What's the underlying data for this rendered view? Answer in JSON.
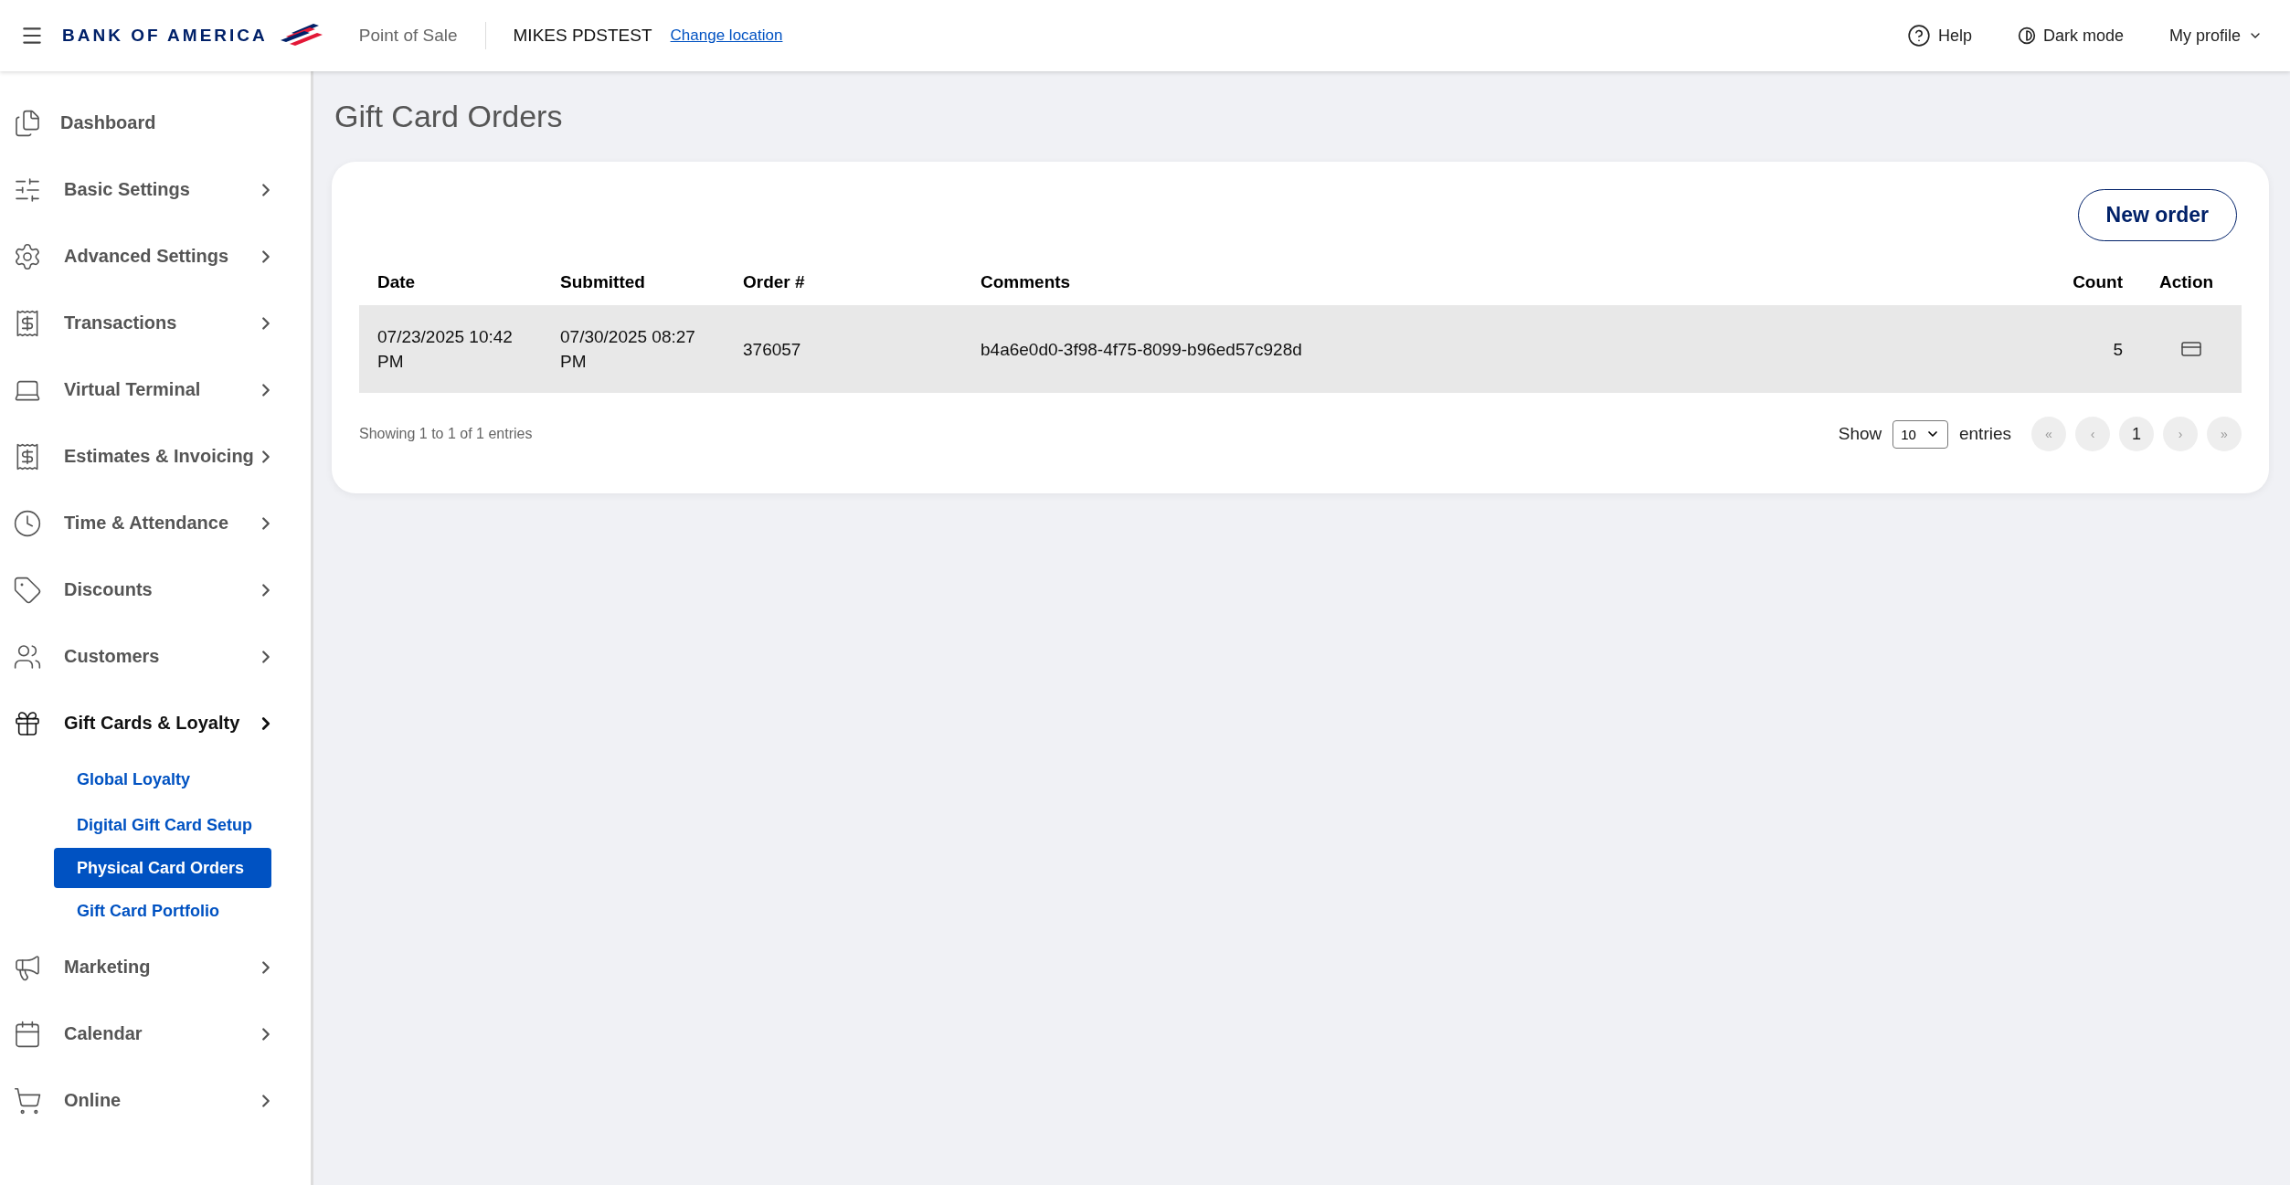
{
  "header": {
    "logo_text": "BANK OF AMERICA",
    "app_name": "Point of Sale",
    "location": "MIKES PDSTEST",
    "change_location": "Change location",
    "help": "Help",
    "dark_mode": "Dark mode",
    "profile": "My profile"
  },
  "sidebar": {
    "items": [
      {
        "label": "Dashboard",
        "kind": "plain"
      },
      {
        "label": "Basic Settings",
        "kind": "group",
        "expanded": false
      },
      {
        "label": "Advanced Settings",
        "kind": "group",
        "expanded": false
      },
      {
        "label": "Transactions",
        "kind": "group",
        "expanded": false
      },
      {
        "label": "Virtual Terminal",
        "kind": "group",
        "expanded": false
      },
      {
        "label": "Estimates & Invoicing",
        "kind": "group",
        "expanded": false
      },
      {
        "label": "Time & Attendance",
        "kind": "group",
        "expanded": false
      },
      {
        "label": "Discounts",
        "kind": "group",
        "expanded": false
      },
      {
        "label": "Customers",
        "kind": "group",
        "expanded": false
      },
      {
        "label": "Gift Cards & Loyalty",
        "kind": "group",
        "expanded": true,
        "children": [
          {
            "label": "Global Loyalty",
            "selected": false
          },
          {
            "label": "Digital Gift Card Setup",
            "selected": false
          },
          {
            "label": "Physical Card Orders",
            "selected": true
          },
          {
            "label": "Gift Card Portfolio",
            "selected": false
          }
        ]
      },
      {
        "label": "Marketing",
        "kind": "group",
        "expanded": false
      },
      {
        "label": "Calendar",
        "kind": "group",
        "expanded": false
      },
      {
        "label": "Online",
        "kind": "group",
        "expanded": false
      }
    ]
  },
  "page": {
    "title": "Gift Card Orders",
    "new_order": "New order"
  },
  "table": {
    "columns": [
      "Date",
      "Submitted",
      "Order #",
      "Comments",
      "Count",
      "Action"
    ],
    "rows": [
      {
        "date": "07/23/2025 10:42 PM",
        "submitted": "07/30/2025 08:27 PM",
        "order": "376057",
        "comments": "b4a6e0d0-3f98-4f75-8099-b96ed57c928d",
        "count": "5"
      }
    ]
  },
  "footer": {
    "info": "Showing 1 to 1 of 1 entries",
    "show": "Show",
    "page_size": "10",
    "entries": "entries",
    "pages": [
      {
        "label": "«",
        "disabled": true
      },
      {
        "label": "‹",
        "disabled": true
      },
      {
        "label": "1",
        "disabled": false
      },
      {
        "label": "›",
        "disabled": true
      },
      {
        "label": "»",
        "disabled": true
      }
    ]
  }
}
